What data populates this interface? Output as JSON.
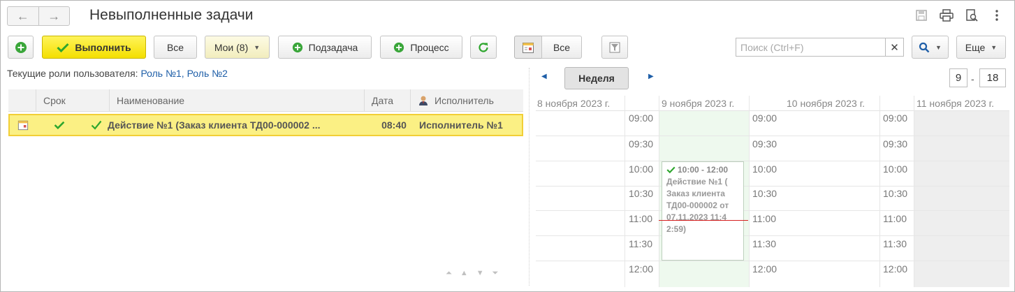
{
  "window": {
    "title": "Невыполненные задачи"
  },
  "toolbar": {
    "execute_label": "Выполнить",
    "all_label": "Все",
    "mine_label": "Мои (8)",
    "subtask_label": "Подзадача",
    "process_label": "Процесс",
    "view_all_label": "Все",
    "search_placeholder": "Поиск (Ctrl+F)",
    "more_label": "Еще"
  },
  "roles": {
    "label": "Текущие роли пользователя:",
    "value": "Роль №1, Роль №2"
  },
  "table": {
    "columns": [
      "Срок",
      "Наименование",
      "Дата",
      "Исполнитель"
    ],
    "rows": [
      {
        "name": "Действие №1 (Заказ клиента ТД00-000002 ...",
        "date": "08:40",
        "executor": "Исполнитель №1"
      }
    ]
  },
  "calendar": {
    "period_button": "Неделя",
    "hours_from": "9",
    "hours_to": "18",
    "days": [
      "8 ноября 2023 г.",
      "9 ноября 2023 г.",
      "10 ноября 2023 г.",
      "11 ноября 2023 г."
    ],
    "times": [
      "09:00",
      "09:30",
      "10:00",
      "10:30",
      "11:00",
      "11:30",
      "12:00"
    ],
    "event": {
      "time": "10:00 - 12:00",
      "title": "Действие №1 ( Заказ клиента ТД00-000002 от 07.11.2023 11:4 2:59)"
    }
  },
  "colors": {
    "accent_yellow": "#f4df00",
    "selected_row": "#fbf084",
    "link_blue": "#1f5fa8",
    "green_check": "#2ea62e",
    "now_line": "#d62020"
  }
}
